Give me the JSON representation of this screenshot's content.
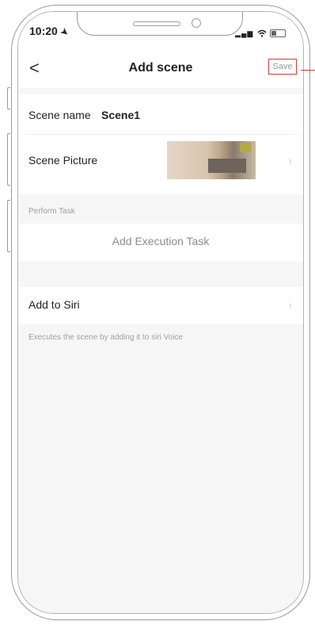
{
  "status_bar": {
    "time": "10:20",
    "location_glyph": "➤",
    "signal_glyph": "▂▄▆"
  },
  "nav": {
    "back_glyph": "<",
    "title": "Add scene",
    "save_label": "Save"
  },
  "scene_name": {
    "label": "Scene name",
    "value": "Scene1"
  },
  "scene_picture": {
    "label": "Scene Picture",
    "chevron": "›"
  },
  "perform_task": {
    "header": "Perform Task",
    "add_label": "Add Execution Task"
  },
  "siri": {
    "label": "Add to Siri",
    "chevron": "›",
    "description": "Executes the scene by adding it to siri Voice"
  },
  "colors": {
    "accent": "#d23b3b",
    "background": "#f6f6f6"
  }
}
